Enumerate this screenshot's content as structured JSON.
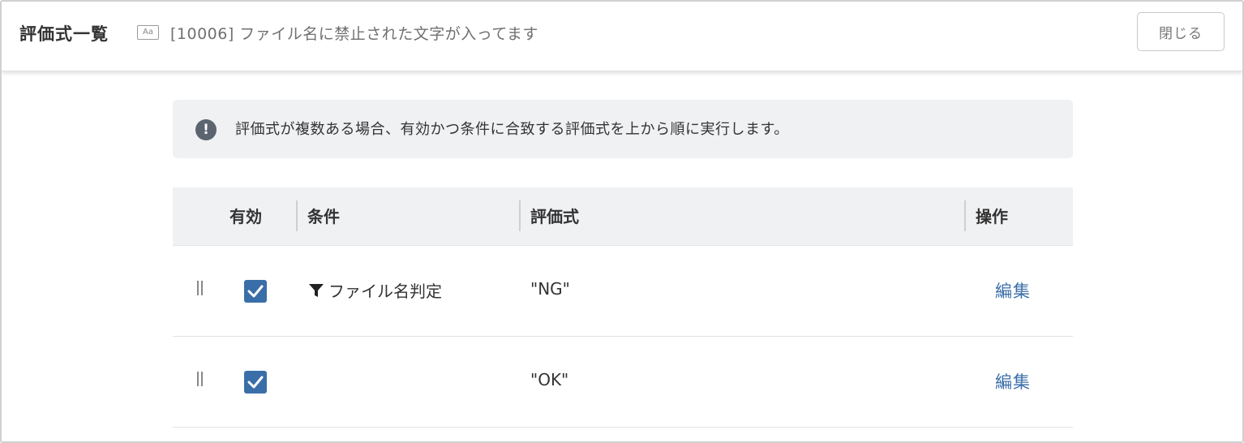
{
  "header": {
    "title": "評価式一覧",
    "rule_icon_label": "Aa",
    "rule_text": "[10006] ファイル名に禁止された文字が入ってます",
    "close_label": "閉じる"
  },
  "info": {
    "icon": "exclamation-circle-icon",
    "message": "評価式が複数ある場合、有効かつ条件に合致する評価式を上から順に実行します。"
  },
  "table": {
    "columns": [
      "有効",
      "条件",
      "評価式",
      "操作"
    ],
    "rows": [
      {
        "enabled": true,
        "condition": "ファイル名判定",
        "condition_icon": "filter-icon",
        "expression": "\"NG\"",
        "action": "編集"
      },
      {
        "enabled": true,
        "condition": "",
        "condition_icon": "",
        "expression": "\"OK\"",
        "action": "編集"
      }
    ]
  },
  "colors": {
    "accent": "#3a6ea8",
    "info_bg": "#f0f1f3",
    "header_bg": "#f0f1f3"
  }
}
